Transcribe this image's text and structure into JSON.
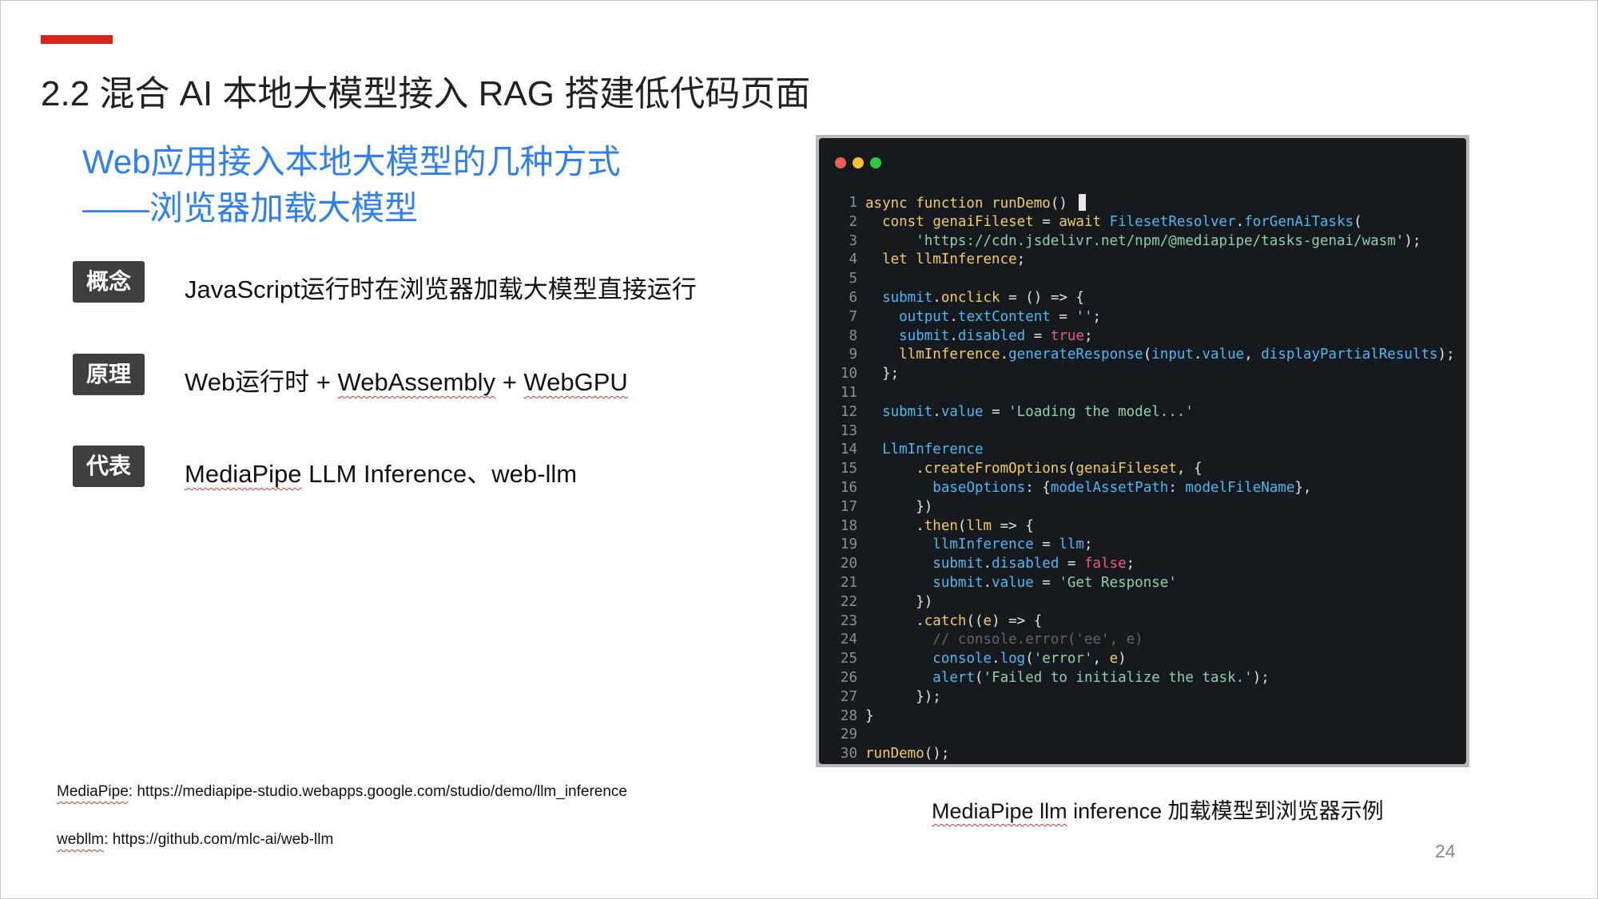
{
  "title": "2.2 混合 AI 本地大模型接入 RAG 搭建低代码页面",
  "subtitle": {
    "line1": "Web应用接入本地大模型的几种方式",
    "line2": "——浏览器加载大模型"
  },
  "items": [
    {
      "label": "概念",
      "text": "JavaScript运行时在浏览器加载大模型直接运行"
    },
    {
      "label": "原理",
      "text_parts": [
        "Web运行时 + ",
        "WebAssembly",
        " + ",
        "WebGPU"
      ]
    },
    {
      "label": "代表",
      "text_parts": [
        "MediaPipe",
        " LLM Inference、web-llm"
      ]
    }
  ],
  "references": [
    {
      "label": "MediaPipe",
      "sep": ": ",
      "url": "https://mediapipe-studio.webapps.google.com/studio/demo/llm_inference"
    },
    {
      "label": "webllm",
      "sep": ":  ",
      "url": "https://github.com/mlc-ai/web-llm"
    }
  ],
  "window_dots": [
    "#ee5f57",
    "#f5be2f",
    "#2bc840"
  ],
  "code_colors": {
    "kw": "#f3cb63",
    "prop": "#4fb8f0",
    "str": "#8fd1a8",
    "bool": "#ef5a7a",
    "comment": "#5d6470",
    "plain": "#dfe3e8"
  },
  "code_lines": [
    {
      "n": "1",
      "parts": [
        [
          "kw",
          "async function"
        ],
        [
          "plain",
          " "
        ],
        [
          "kw",
          "runDemo"
        ],
        [
          "plain",
          "() "
        ]
      ],
      "cursor": true
    },
    {
      "n": "2",
      "parts": [
        [
          "plain",
          "  "
        ],
        [
          "kw",
          "const"
        ],
        [
          "plain",
          " "
        ],
        [
          "kw",
          "genaiFileset"
        ],
        [
          "plain",
          " = "
        ],
        [
          "kw",
          "await"
        ],
        [
          "plain",
          " "
        ],
        [
          "prop",
          "FilesetResolver"
        ],
        [
          "plain",
          "."
        ],
        [
          "prop",
          "forGenAiTasks"
        ],
        [
          "plain",
          "("
        ]
      ]
    },
    {
      "n": "3",
      "parts": [
        [
          "plain",
          "      "
        ],
        [
          "str",
          "'https://cdn.jsdelivr.net/npm/@mediapipe/tasks-genai/wasm'"
        ],
        [
          "plain",
          ");"
        ]
      ]
    },
    {
      "n": "4",
      "parts": [
        [
          "plain",
          "  "
        ],
        [
          "kw",
          "let"
        ],
        [
          "plain",
          " "
        ],
        [
          "kw",
          "llmInference"
        ],
        [
          "plain",
          ";"
        ]
      ]
    },
    {
      "n": "5",
      "parts": []
    },
    {
      "n": "6",
      "parts": [
        [
          "plain",
          "  "
        ],
        [
          "prop",
          "submit"
        ],
        [
          "plain",
          "."
        ],
        [
          "kw",
          "onclick"
        ],
        [
          "plain",
          " = () => {"
        ]
      ]
    },
    {
      "n": "7",
      "parts": [
        [
          "plain",
          "    "
        ],
        [
          "prop",
          "output"
        ],
        [
          "plain",
          "."
        ],
        [
          "prop",
          "textContent"
        ],
        [
          "plain",
          " = "
        ],
        [
          "str",
          "''"
        ],
        [
          "plain",
          ";"
        ]
      ]
    },
    {
      "n": "8",
      "parts": [
        [
          "plain",
          "    "
        ],
        [
          "prop",
          "submit"
        ],
        [
          "plain",
          "."
        ],
        [
          "prop",
          "disabled"
        ],
        [
          "plain",
          " = "
        ],
        [
          "bool",
          "true"
        ],
        [
          "plain",
          ";"
        ]
      ]
    },
    {
      "n": "9",
      "parts": [
        [
          "plain",
          "    "
        ],
        [
          "kw",
          "llmInference"
        ],
        [
          "plain",
          "."
        ],
        [
          "prop",
          "generateResponse"
        ],
        [
          "plain",
          "("
        ],
        [
          "prop",
          "input"
        ],
        [
          "plain",
          "."
        ],
        [
          "prop",
          "value"
        ],
        [
          "plain",
          ", "
        ],
        [
          "prop",
          "displayPartialResults"
        ],
        [
          "plain",
          ");"
        ]
      ]
    },
    {
      "n": "10",
      "parts": [
        [
          "plain",
          "  };"
        ]
      ]
    },
    {
      "n": "11",
      "parts": []
    },
    {
      "n": "12",
      "parts": [
        [
          "plain",
          "  "
        ],
        [
          "prop",
          "submit"
        ],
        [
          "plain",
          "."
        ],
        [
          "prop",
          "value"
        ],
        [
          "plain",
          " = "
        ],
        [
          "str",
          "'Loading the model...'"
        ]
      ]
    },
    {
      "n": "13",
      "parts": []
    },
    {
      "n": "14",
      "parts": [
        [
          "plain",
          "  "
        ],
        [
          "prop",
          "LlmInference"
        ]
      ]
    },
    {
      "n": "15",
      "parts": [
        [
          "plain",
          "      ."
        ],
        [
          "kw",
          "createFromOptions"
        ],
        [
          "plain",
          "("
        ],
        [
          "kw",
          "genaiFileset"
        ],
        [
          "plain",
          ", {"
        ]
      ]
    },
    {
      "n": "16",
      "parts": [
        [
          "plain",
          "        "
        ],
        [
          "prop",
          "baseOptions"
        ],
        [
          "plain",
          ": {"
        ],
        [
          "prop",
          "modelAssetPath"
        ],
        [
          "plain",
          ": "
        ],
        [
          "prop",
          "modelFileName"
        ],
        [
          "plain",
          "},"
        ]
      ]
    },
    {
      "n": "17",
      "parts": [
        [
          "plain",
          "      })"
        ]
      ]
    },
    {
      "n": "18",
      "parts": [
        [
          "plain",
          "      ."
        ],
        [
          "kw",
          "then"
        ],
        [
          "plain",
          "("
        ],
        [
          "kw",
          "llm"
        ],
        [
          "plain",
          " => {"
        ]
      ]
    },
    {
      "n": "19",
      "parts": [
        [
          "plain",
          "        "
        ],
        [
          "prop",
          "llmInference"
        ],
        [
          "plain",
          " = "
        ],
        [
          "prop",
          "llm"
        ],
        [
          "plain",
          ";"
        ]
      ]
    },
    {
      "n": "20",
      "parts": [
        [
          "plain",
          "        "
        ],
        [
          "prop",
          "submit"
        ],
        [
          "plain",
          "."
        ],
        [
          "prop",
          "disabled"
        ],
        [
          "plain",
          " = "
        ],
        [
          "bool",
          "false"
        ],
        [
          "plain",
          ";"
        ]
      ]
    },
    {
      "n": "21",
      "parts": [
        [
          "plain",
          "        "
        ],
        [
          "prop",
          "submit"
        ],
        [
          "plain",
          "."
        ],
        [
          "prop",
          "value"
        ],
        [
          "plain",
          " = "
        ],
        [
          "str",
          "'Get Response'"
        ]
      ]
    },
    {
      "n": "22",
      "parts": [
        [
          "plain",
          "      })"
        ]
      ]
    },
    {
      "n": "23",
      "parts": [
        [
          "plain",
          "      ."
        ],
        [
          "kw",
          "catch"
        ],
        [
          "plain",
          "(("
        ],
        [
          "kw",
          "e"
        ],
        [
          "plain",
          ") => {"
        ]
      ]
    },
    {
      "n": "24",
      "parts": [
        [
          "plain",
          "        "
        ],
        [
          "comment",
          "// console.error('ee', e)"
        ]
      ]
    },
    {
      "n": "25",
      "parts": [
        [
          "plain",
          "        "
        ],
        [
          "prop",
          "console"
        ],
        [
          "plain",
          "."
        ],
        [
          "prop",
          "log"
        ],
        [
          "plain",
          "("
        ],
        [
          "str",
          "'error'"
        ],
        [
          "plain",
          ", "
        ],
        [
          "kw",
          "e"
        ],
        [
          "plain",
          ")"
        ]
      ]
    },
    {
      "n": "26",
      "parts": [
        [
          "plain",
          "        "
        ],
        [
          "prop",
          "alert"
        ],
        [
          "plain",
          "("
        ],
        [
          "str",
          "'Failed to initialize the task.'"
        ],
        [
          "plain",
          ");"
        ]
      ]
    },
    {
      "n": "27",
      "parts": [
        [
          "plain",
          "      });"
        ]
      ]
    },
    {
      "n": "28",
      "parts": [
        [
          "plain",
          "}"
        ]
      ]
    },
    {
      "n": "29",
      "parts": []
    },
    {
      "n": "30",
      "parts": [
        [
          "kw",
          "runDemo"
        ],
        [
          "plain",
          "();"
        ]
      ]
    }
  ],
  "caption_parts": [
    "MediaPipe llm",
    " inference 加载模型到浏览器示例"
  ],
  "page_number": "24"
}
